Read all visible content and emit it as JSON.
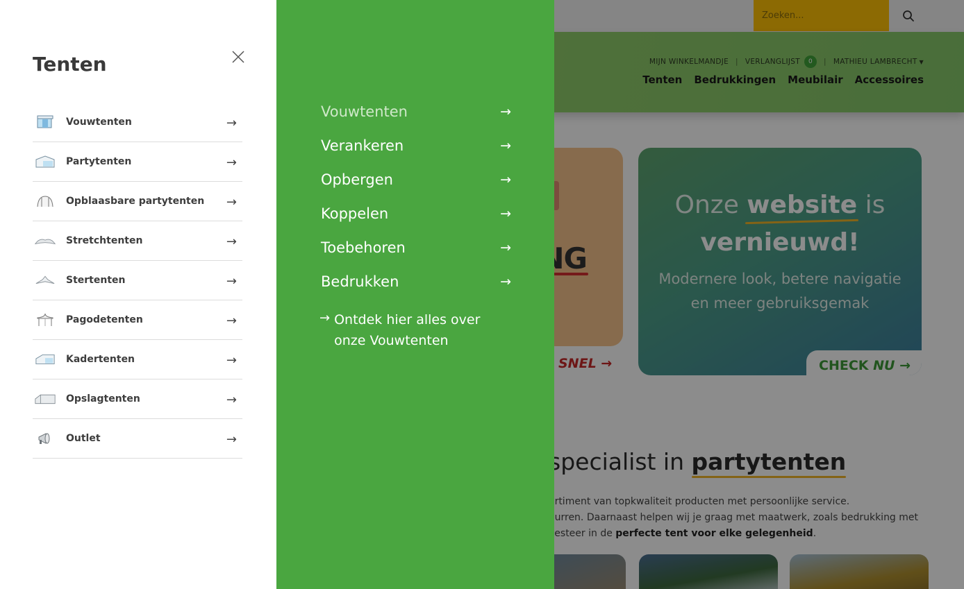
{
  "search": {
    "placeholder": "Zoeken..."
  },
  "header": {
    "cart": "MIJN WINKELMANDJE",
    "wishlist": "VERLANGLIJST",
    "wishlist_count": "0",
    "user": "MATHIEU LAMBRECHT",
    "nav": [
      "Tenten",
      "Bedrukkingen",
      "Meubilair",
      "Accessoires"
    ]
  },
  "hero_left": {
    "big_text": "NG",
    "cta_word": "SNEL",
    "cta_arrow": "→"
  },
  "hero_right": {
    "title_pre": "Onze",
    "title_bold": "website",
    "title_post": "is",
    "title_line2": "vernieuwd!",
    "subtitle_line1": "Modernere look, betere navigatie",
    "subtitle_line2": "en meer gebruiksgemak",
    "cta_pre": "CHECK",
    "cta_italic": "NU",
    "cta_arrow": "→"
  },
  "section": {
    "heading_pre": "specialist in",
    "heading_bold": "partytenten",
    "intro_line1": "ortiment van topkwaliteit producten met persoonlijke service.",
    "intro_line2": "eurren. Daarnaast helpen wij je graag met maatwerk, zoals bedrukking met",
    "intro_line3_pre": "vesteer in de",
    "intro_line3_bold": "perfecte tent voor elke gelegenheid",
    "intro_line3_post": "."
  },
  "side_menu": {
    "title": "Tenten",
    "arrow": "→",
    "items": [
      {
        "label": "Vouwtenten",
        "icon": "folding-tent-icon"
      },
      {
        "label": "Partytenten",
        "icon": "party-tent-icon"
      },
      {
        "label": "Opblaasbare partytenten",
        "icon": "inflatable-tent-icon"
      },
      {
        "label": "Stretchtenten",
        "icon": "stretch-tent-icon"
      },
      {
        "label": "Stertenten",
        "icon": "star-tent-icon"
      },
      {
        "label": "Pagodetenten",
        "icon": "pagoda-tent-icon"
      },
      {
        "label": "Kadertenten",
        "icon": "frame-tent-icon"
      },
      {
        "label": "Opslagtenten",
        "icon": "storage-tent-icon"
      },
      {
        "label": "Outlet",
        "icon": "megaphone-icon"
      }
    ]
  },
  "sub_menu": {
    "arrow": "→",
    "items": [
      {
        "label": "Vouwtenten",
        "active": true
      },
      {
        "label": "Verankeren",
        "active": false
      },
      {
        "label": "Opbergen",
        "active": false
      },
      {
        "label": "Koppelen",
        "active": false
      },
      {
        "label": "Toebehoren",
        "active": false
      },
      {
        "label": "Bedrukken",
        "active": false
      }
    ],
    "discover_arrow": "→",
    "discover_text": "Ontdek hier alles over onze Vouwtenten"
  },
  "colors": {
    "green_panel": "#4aa640",
    "search_bg": "#ffc107",
    "accent_underline": "#f0b429",
    "snel_red": "#c62828"
  }
}
